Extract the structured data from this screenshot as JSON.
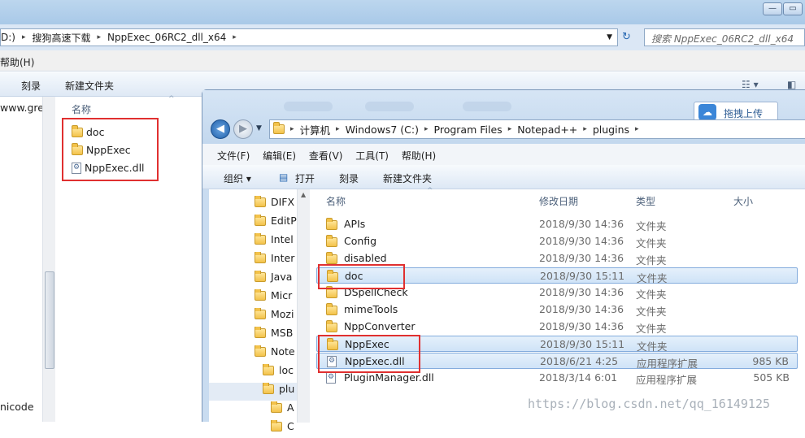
{
  "bg": {
    "address": [
      "D:)",
      "搜狗高速下载",
      "NppExec_06RC2_dll_x64"
    ],
    "search_placeholder": "搜索 NppExec_06RC2_dll_x64",
    "menu": {
      "help": "帮助(H)"
    },
    "toolbar": {
      "burn": "刻录",
      "new_folder": "新建文件夹"
    },
    "nav_text": "www.gree",
    "nav_bottom": "nicode",
    "col_name": "名称",
    "files": [
      {
        "name": "doc",
        "type": "folder"
      },
      {
        "name": "NppExec",
        "type": "folder"
      },
      {
        "name": "NppExec.dll",
        "type": "dll"
      }
    ]
  },
  "fg": {
    "badge": "拖拽上传",
    "address": [
      "计算机",
      "Windows7 (C:)",
      "Program Files",
      "Notepad++",
      "plugins"
    ],
    "menu": [
      "文件(F)",
      "编辑(E)",
      "查看(V)",
      "工具(T)",
      "帮助(H)"
    ],
    "toolbar": {
      "organize": "组织 ▾",
      "open": "打开",
      "burn": "刻录",
      "new_folder": "新建文件夹"
    },
    "nav": [
      "DIFX",
      "EditP",
      "Intel",
      "Inter",
      "Java",
      "Micr",
      "Mozi",
      "MSB",
      "Note",
      "loc",
      "plu",
      "A",
      "C"
    ],
    "columns": {
      "name": "名称",
      "modified": "修改日期",
      "type": "类型",
      "size": "大小"
    },
    "rows": [
      {
        "name": "APIs",
        "icon": "folder",
        "date": "2018/9/30 14:36",
        "type": "文件夹",
        "size": "",
        "selected": false
      },
      {
        "name": "Config",
        "icon": "folder",
        "date": "2018/9/30 14:36",
        "type": "文件夹",
        "size": "",
        "selected": false
      },
      {
        "name": "disabled",
        "icon": "folder",
        "date": "2018/9/30 14:36",
        "type": "文件夹",
        "size": "",
        "selected": false
      },
      {
        "name": "doc",
        "icon": "folder",
        "date": "2018/9/30 15:11",
        "type": "文件夹",
        "size": "",
        "selected": true
      },
      {
        "name": "DSpellCheck",
        "icon": "folder",
        "date": "2018/9/30 14:36",
        "type": "文件夹",
        "size": "",
        "selected": false
      },
      {
        "name": "mimeTools",
        "icon": "folder",
        "date": "2018/9/30 14:36",
        "type": "文件夹",
        "size": "",
        "selected": false
      },
      {
        "name": "NppConverter",
        "icon": "folder",
        "date": "2018/9/30 14:36",
        "type": "文件夹",
        "size": "",
        "selected": false
      },
      {
        "name": "NppExec",
        "icon": "folder",
        "date": "2018/9/30 15:11",
        "type": "文件夹",
        "size": "",
        "selected": true
      },
      {
        "name": "NppExec.dll",
        "icon": "dll",
        "date": "2018/6/21 4:25",
        "type": "应用程序扩展",
        "size": "985 KB",
        "selected": true
      },
      {
        "name": "PluginManager.dll",
        "icon": "dll",
        "date": "2018/3/14 6:01",
        "type": "应用程序扩展",
        "size": "505 KB",
        "selected": false
      }
    ]
  },
  "watermark": "https://blog.csdn.net/qq_16149125",
  "colors": {
    "highlight": "#e03030",
    "selection": "#cfe3f7"
  }
}
